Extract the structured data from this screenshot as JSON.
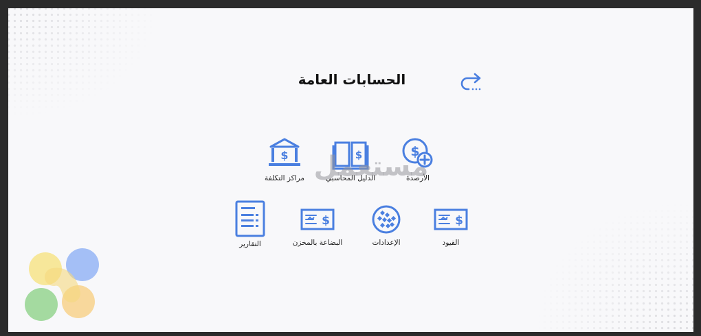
{
  "header": {
    "title": "الحسابات العامة"
  },
  "icons": {
    "back": "return-arrow-icon"
  },
  "tiles_row1": [
    {
      "label": "الأرصدة",
      "icon": "coin-plus-icon"
    },
    {
      "label": "الدليل المحاسبي",
      "icon": "book-dollar-icon"
    },
    {
      "label": "مراكز التكلفة",
      "icon": "bank-icon"
    }
  ],
  "tiles_row2": [
    {
      "label": "القيود",
      "icon": "check-dollar-icon"
    },
    {
      "label": "الإعدادات",
      "icon": "webmoney-icon"
    },
    {
      "label": "البضاعة بالمخزن",
      "icon": "check-dollar-icon"
    },
    {
      "label": "التقارير",
      "icon": "report-document-icon"
    }
  ],
  "watermark": {
    "text": "مستعمل"
  },
  "colors": {
    "accent": "#4a7fe0",
    "background": "#f8f8fa"
  }
}
